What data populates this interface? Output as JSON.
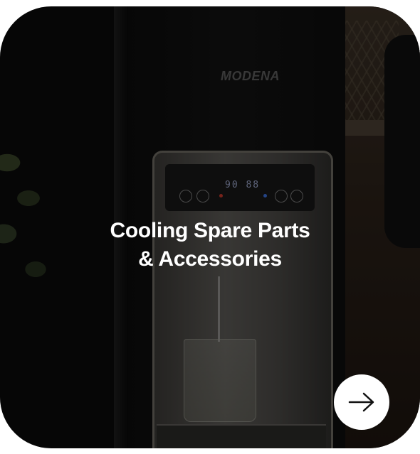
{
  "card": {
    "title_line1": "Cooling Spare Parts",
    "title_line2": "& Accessories",
    "brand_text": "MODENA",
    "panel_display": "90  88",
    "action_icon": "arrow-right-icon",
    "text_color": "#ffffff",
    "button_color": "#ffffff"
  }
}
